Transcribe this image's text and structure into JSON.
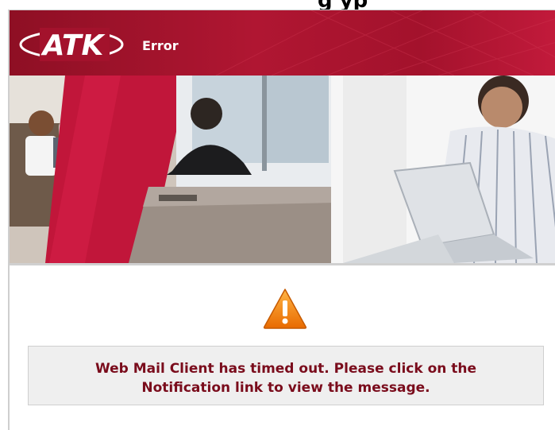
{
  "page": {
    "cut_heading": "g   yp"
  },
  "header": {
    "logo_text": "ATK",
    "title": "Error",
    "colors": {
      "primary": "#a3122c",
      "dark": "#8e0f24"
    }
  },
  "banner": {
    "image": "hero-collage-family-office-laptop"
  },
  "alert": {
    "icon": "warning-icon",
    "message_line1": "Web Mail Client has timed out. Please click on the",
    "message_line2": "Notification link to view the message.",
    "colors": {
      "text": "#7a0c1c",
      "icon": "#f08a12"
    }
  }
}
